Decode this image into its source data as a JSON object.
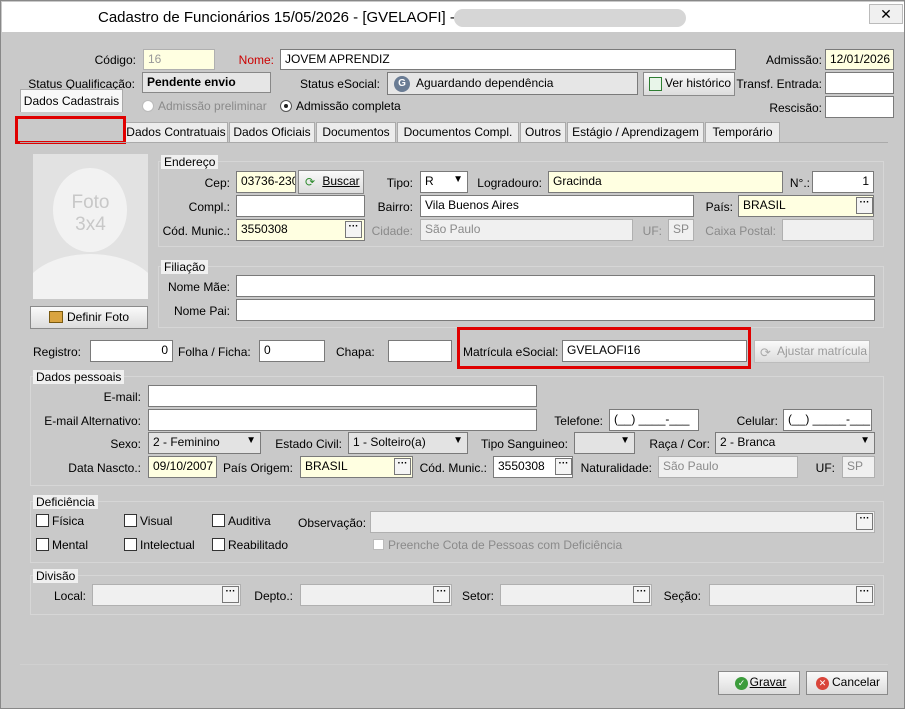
{
  "window": {
    "title": "Cadastro de Funcionários  15/05/2026 - [GVELAOFI] -",
    "close": "✕"
  },
  "header": {
    "codigo_label": "Código:",
    "codigo_value": "16",
    "nome_label": "Nome:",
    "nome_value": "JOVEM APRENDIZ",
    "admissao_label": "Admissão:",
    "admissao_value": "12/01/2026",
    "status_qual_label": "Status Qualificação:",
    "status_qual_value": "Pendente envio",
    "status_esocial_label": "Status eSocial:",
    "status_esocial_value": "Aguardando dependência",
    "ver_historico": "Ver histórico",
    "transf_label": "Transf. Entrada:",
    "rescisao_label": "Rescisão:",
    "radio_preliminar": "Admissão preliminar",
    "radio_completa": "Admissão completa"
  },
  "tabs": [
    "Dados Cadastrais",
    "Dados Contratuais",
    "Dados Oficiais",
    "Documentos",
    "Documentos Compl.",
    "Outros",
    "Estágio / Aprendizagem",
    "Temporário"
  ],
  "photo": {
    "text1": "Foto",
    "text2": "3x4",
    "button": "Definir Foto"
  },
  "endereco": {
    "title": "Endereço",
    "cep_label": "Cep:",
    "cep_value": "03736-230",
    "buscar": "Buscar",
    "tipo_label": "Tipo:",
    "tipo_value": "R",
    "logradouro_label": "Logradouro:",
    "logradouro_value": "Gracinda",
    "numero_label": "N°.:",
    "numero_value": "1",
    "compl_label": "Compl.:",
    "compl_value": "",
    "bairro_label": "Bairro:",
    "bairro_value": "Vila Buenos Aires",
    "pais_label": "País:",
    "pais_value": "BRASIL",
    "codmunic_label": "Cód. Munic.:",
    "codmunic_value": "3550308",
    "cidade_label": "Cidade:",
    "cidade_value": "São Paulo",
    "uf_label": "UF:",
    "uf_value": "SP",
    "caixa_label": "Caixa Postal:",
    "caixa_value": ""
  },
  "filiacao": {
    "title": "Filiação",
    "mae_label": "Nome Mãe:",
    "pai_label": "Nome Pai:"
  },
  "registro": {
    "registro_label": "Registro:",
    "registro_value": "0",
    "folha_label": "Folha / Ficha:",
    "folha_value": "0",
    "chapa_label": "Chapa:",
    "chapa_value": "",
    "matricula_label": "Matrícula eSocial:",
    "matricula_value": "GVELAOFI16",
    "ajustar": "Ajustar matrícula"
  },
  "pessoais": {
    "title": "Dados pessoais",
    "email_label": "E-mail:",
    "email_alt_label": "E-mail Alternativo:",
    "telefone_label": "Telefone:",
    "telefone_value": "(__) ____-___",
    "celular_label": "Celular:",
    "celular_value": "(__) _____-___",
    "sexo_label": "Sexo:",
    "sexo_value": "2  -  Feminino",
    "estado_civil_label": "Estado Civil:",
    "estado_civil_value": "1  -  Solteiro(a)",
    "sangue_label": "Tipo Sanguineo:",
    "sangue_value": "",
    "raca_label": "Raça / Cor:",
    "raca_value": "2  -  Branca",
    "nasc_label": "Data Nascto.:",
    "nasc_value": "09/10/2007",
    "pais_origem_label": "País Origem:",
    "pais_origem_value": "BRASIL",
    "codmunic_label": "Cód. Munic.:",
    "codmunic_value": "3550308",
    "natural_label": "Naturalidade:",
    "natural_value": "São Paulo",
    "uf_label": "UF:",
    "uf_value": "SP"
  },
  "deficiencia": {
    "title": "Deficiência",
    "fisica": "Física",
    "visual": "Visual",
    "auditiva": "Auditiva",
    "mental": "Mental",
    "intelectual": "Intelectual",
    "reabilitado": "Reabilitado",
    "observacao_label": "Observação:",
    "cota": "Preenche Cota de Pessoas com Deficiência"
  },
  "divisao": {
    "title": "Divisão",
    "local_label": "Local:",
    "depto_label": "Depto.:",
    "setor_label": "Setor:",
    "secao_label": "Seção:"
  },
  "footer": {
    "gravar": "Gravar",
    "cancelar": "Cancelar"
  },
  "colors": {
    "highlight": "#e00000",
    "yellow_field": "#ffffe1",
    "required_label": "#cc0000"
  }
}
